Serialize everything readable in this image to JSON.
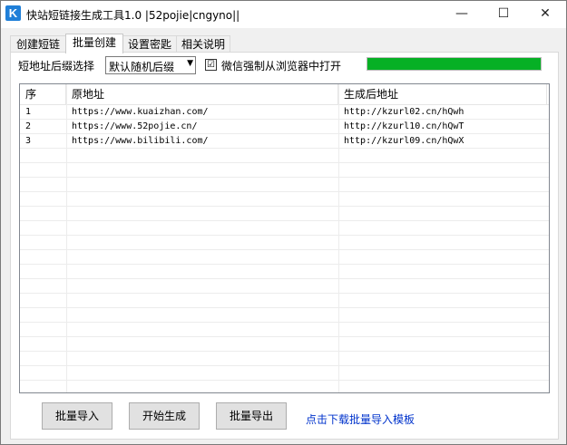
{
  "window": {
    "title": "快站短链接生成工具1.0 |52pojie|cngyno||",
    "icon": "K",
    "controls": [
      "—",
      "☐",
      "✕"
    ]
  },
  "tabs": [
    {
      "label": "创建短链"
    },
    {
      "label": "批量创建",
      "active": true
    },
    {
      "label": "设置密匙"
    },
    {
      "label": "相关说明"
    }
  ],
  "options": {
    "suffix_label": "短地址后缀选择",
    "suffix_selected": "默认随机后缀",
    "wechat_checked": "☑",
    "wechat_label": "微信强制从浏览器中打开",
    "progress_fraction": 1.0,
    "progress_color": "#06b025"
  },
  "table": {
    "headers": [
      "序",
      "原地址",
      "生成后地址"
    ],
    "rows": [
      [
        "1",
        "https://www.kuaizhan.com/",
        "http://kzurl02.cn/hQwh"
      ],
      [
        "2",
        "https://www.52pojie.cn/",
        "http://kzurl10.cn/hQwT"
      ],
      [
        "3",
        "https://www.bilibili.com/",
        "http://kzurl09.cn/hQwX"
      ]
    ]
  },
  "buttons": {
    "import": "批量导入",
    "generate": "开始生成",
    "export": "批量导出"
  },
  "link": {
    "download_template": "点击下载批量导入模板",
    "color": "#0033cc"
  }
}
